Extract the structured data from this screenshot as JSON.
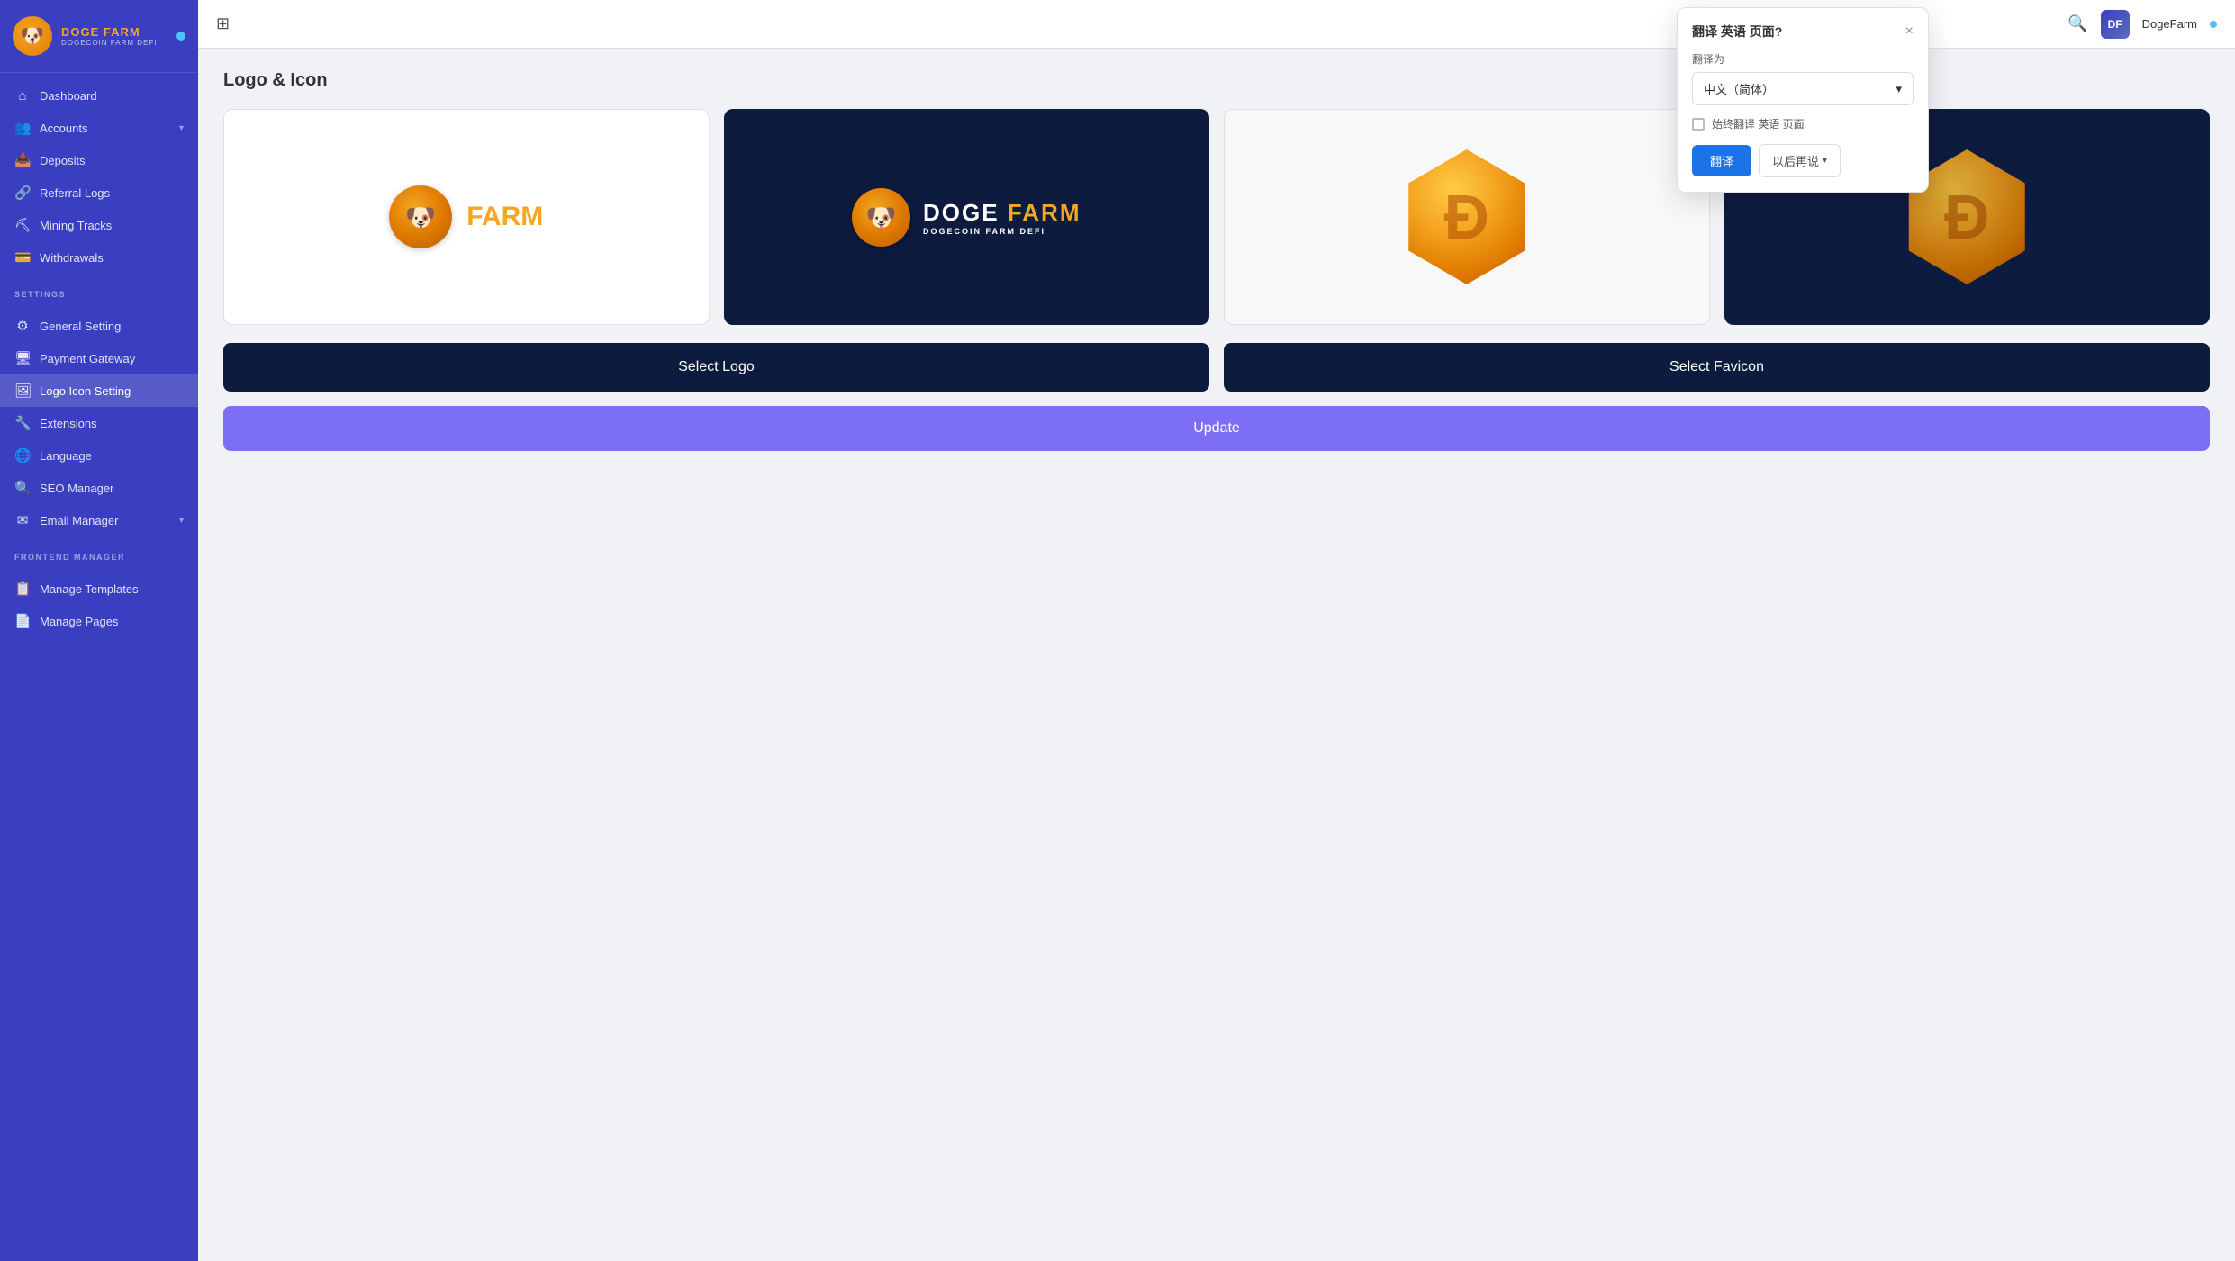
{
  "sidebar": {
    "brand": {
      "name_white": "DOGE ",
      "name_orange": "FARM",
      "sub": "DOGECOIN FARM DEFI"
    },
    "nav_main": [
      {
        "id": "dashboard",
        "label": "Dashboard",
        "icon": "⌂",
        "active": false
      },
      {
        "id": "accounts",
        "label": "Accounts",
        "icon": "👥",
        "active": false,
        "has_chevron": true
      },
      {
        "id": "deposits",
        "label": "Deposits",
        "icon": "📥",
        "active": false
      },
      {
        "id": "referral-logs",
        "label": "Referral Logs",
        "icon": "🔗",
        "active": false
      },
      {
        "id": "mining-tracks",
        "label": "Mining Tracks",
        "icon": "⛏",
        "active": false
      },
      {
        "id": "withdrawals",
        "label": "Withdrawals",
        "icon": "💳",
        "active": false
      }
    ],
    "settings_label": "SETTINGS",
    "nav_settings": [
      {
        "id": "general-setting",
        "label": "General Setting",
        "icon": "⚙",
        "active": false
      },
      {
        "id": "payment-gateway",
        "label": "Payment Gateway",
        "icon": "🖥",
        "active": false
      },
      {
        "id": "logo-icon-setting",
        "label": "Logo Icon Setting",
        "icon": "🖼",
        "active": true
      },
      {
        "id": "extensions",
        "label": "Extensions",
        "icon": "🔧",
        "active": false
      },
      {
        "id": "language",
        "label": "Language",
        "icon": "🌐",
        "active": false
      },
      {
        "id": "seo-manager",
        "label": "SEO Manager",
        "icon": "🔍",
        "active": false
      },
      {
        "id": "email-manager",
        "label": "Email Manager",
        "icon": "✉",
        "active": false,
        "has_chevron": true
      }
    ],
    "frontend_label": "FRONTEND MANAGER",
    "nav_frontend": [
      {
        "id": "manage-templates",
        "label": "Manage Templates",
        "icon": "📋",
        "active": false
      },
      {
        "id": "manage-pages",
        "label": "Manage Pages",
        "icon": "📄",
        "active": false
      }
    ]
  },
  "topbar": {
    "expand_icon": "⊞",
    "search_icon": "🔍",
    "username": "DogeFarm",
    "user_initials": "DF"
  },
  "main": {
    "page_title": "Logo & Icon",
    "select_logo_btn": "Select Logo",
    "select_favicon_btn": "Select Favicon",
    "update_btn": "Update"
  },
  "translate_popup": {
    "title": "翻译 英语 页面?",
    "translate_to_label": "翻译为",
    "language_selected": "中文（简体）",
    "always_translate_label": "始终翻译 英语 页面",
    "confirm_btn": "翻译",
    "later_btn": "以后再说",
    "close_icon": "×"
  }
}
